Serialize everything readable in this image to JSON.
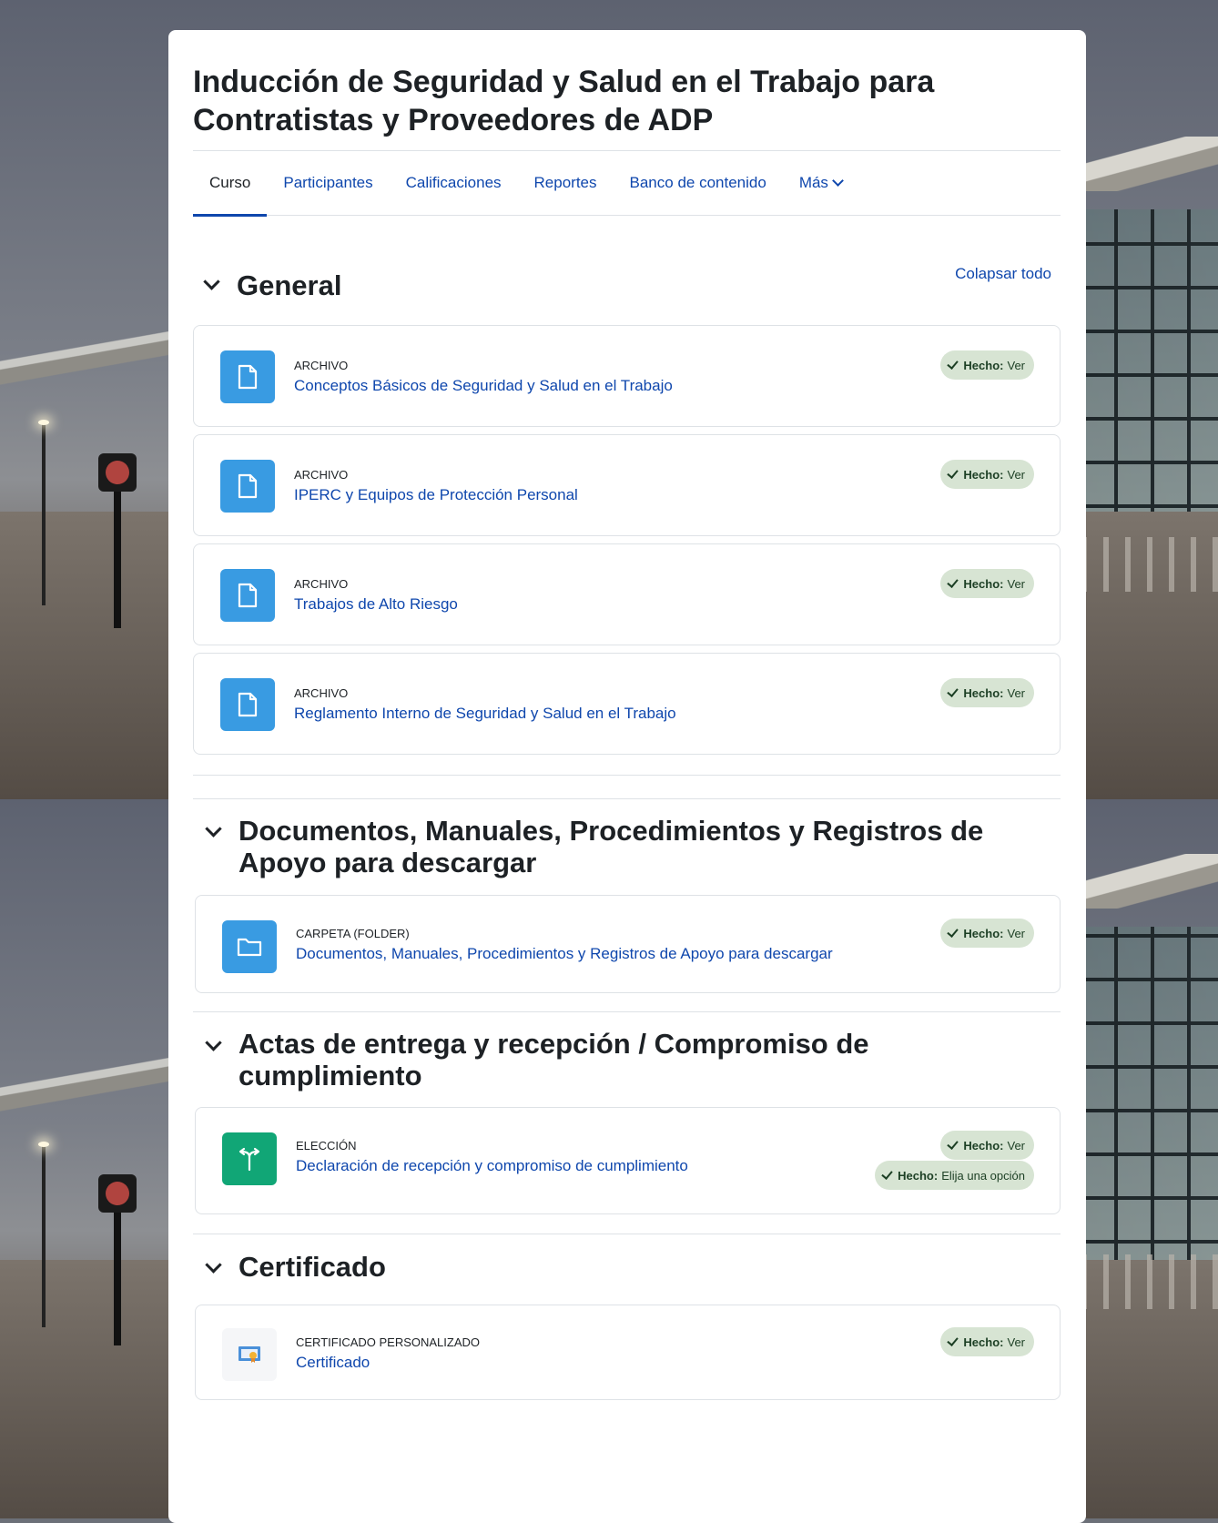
{
  "course": {
    "title": "Inducción de Seguridad y Salud en el Trabajo para Contratistas y Proveedores de ADP"
  },
  "tabs": [
    {
      "label": "Curso",
      "active": true
    },
    {
      "label": "Participantes"
    },
    {
      "label": "Calificaciones"
    },
    {
      "label": "Reportes"
    },
    {
      "label": "Banco de contenido"
    },
    {
      "label": "Más"
    }
  ],
  "collapse_all": "Colapsar todo",
  "completion": {
    "done_label": "Hecho:",
    "view_label": "Ver",
    "choose_label": "Elija una opción"
  },
  "sections": [
    {
      "title": "General",
      "activities": [
        {
          "type": "ARCHIVO",
          "name": "Conceptos Básicos de Seguridad y Salud en el Trabajo",
          "icon": "file-icon"
        },
        {
          "type": "ARCHIVO",
          "name": "IPERC y Equipos de Protección Personal",
          "icon": "file-icon"
        },
        {
          "type": "ARCHIVO",
          "name": "Trabajos de Alto Riesgo",
          "icon": "file-icon"
        },
        {
          "type": "ARCHIVO",
          "name": "Reglamento Interno de Seguridad y Salud en el Trabajo",
          "icon": "file-icon"
        }
      ]
    },
    {
      "title": "Documentos, Manuales, Procedimientos y Registros de Apoyo para descargar",
      "activities": [
        {
          "type": "CARPETA (FOLDER)",
          "name": "Documentos, Manuales, Procedimientos y Registros de Apoyo para descargar",
          "icon": "folder-icon"
        }
      ]
    },
    {
      "title": "Actas de entrega y recepción / Compromiso de cumplimiento",
      "activities": [
        {
          "type": "ELECCIÓN",
          "name": "Declaración de recepción y compromiso de cumplimiento",
          "icon": "choice-icon"
        }
      ]
    },
    {
      "title": "Certificado",
      "activities": [
        {
          "type": "CERTIFICADO PERSONALIZADO",
          "name": "Certificado",
          "icon": "certificate-icon"
        }
      ]
    }
  ],
  "colors": {
    "link": "#0f47ad",
    "file_icon_bg": "#399be2",
    "choice_icon_bg": "#11a676",
    "badge_bg": "#d7e4d3"
  }
}
